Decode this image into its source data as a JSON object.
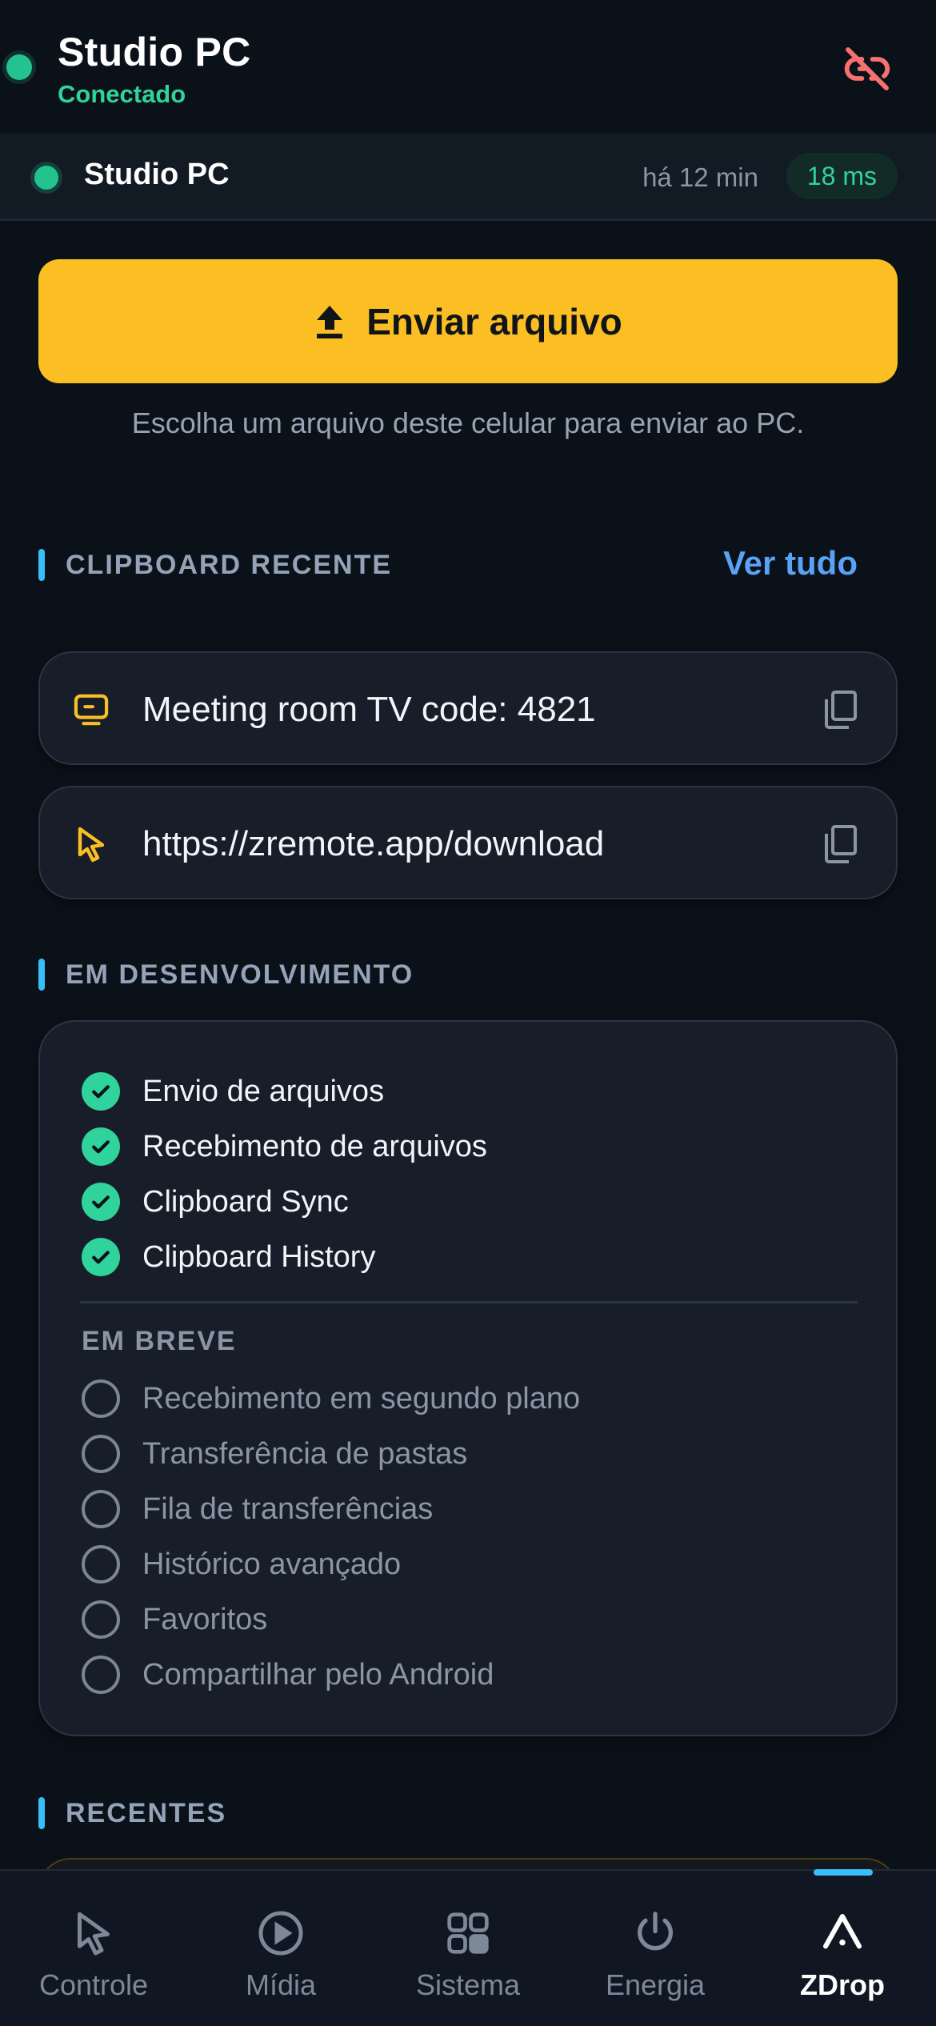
{
  "header": {
    "title": "Studio PC",
    "status": "Conectado",
    "status_color": "#2fd39b",
    "disconnect_icon": "unlink-icon"
  },
  "device": {
    "name": "Studio PC",
    "last_seen": "há 12 min",
    "latency": "18 ms"
  },
  "send": {
    "label": "Enviar arquivo",
    "hint": "Escolha um arquivo deste celular para enviar ao PC.",
    "accent": "#fbbf24"
  },
  "clipboard": {
    "heading": "CLIPBOARD RECENTE",
    "see_all": "Ver tudo",
    "items": [
      {
        "text": "Meeting room TV code: 4821",
        "icon": "tv-icon"
      },
      {
        "text": "https://zremote.app/download",
        "icon": "cursor-icon"
      }
    ]
  },
  "development": {
    "heading": "EM DESENVOLVIMENTO",
    "done": [
      "Envio de arquivos",
      "Recebimento de arquivos",
      "Clipboard Sync",
      "Clipboard History"
    ],
    "soon_label": "EM BREVE",
    "soon": [
      "Recebimento em segundo plano",
      "Transferência de pastas",
      "Fila de transferências",
      "Histórico avançado",
      "Favoritos",
      "Compartilhar pelo Android"
    ]
  },
  "recent": {
    "heading": "RECENTES"
  },
  "nav": {
    "active": "ZDrop",
    "items": [
      {
        "label": "Controle",
        "icon": "cursor-icon"
      },
      {
        "label": "Mídia",
        "icon": "play-circle-icon"
      },
      {
        "label": "Sistema",
        "icon": "grid-icon"
      },
      {
        "label": "Energia",
        "icon": "power-icon"
      },
      {
        "label": "ZDrop",
        "icon": "zdrop-icon"
      }
    ]
  }
}
